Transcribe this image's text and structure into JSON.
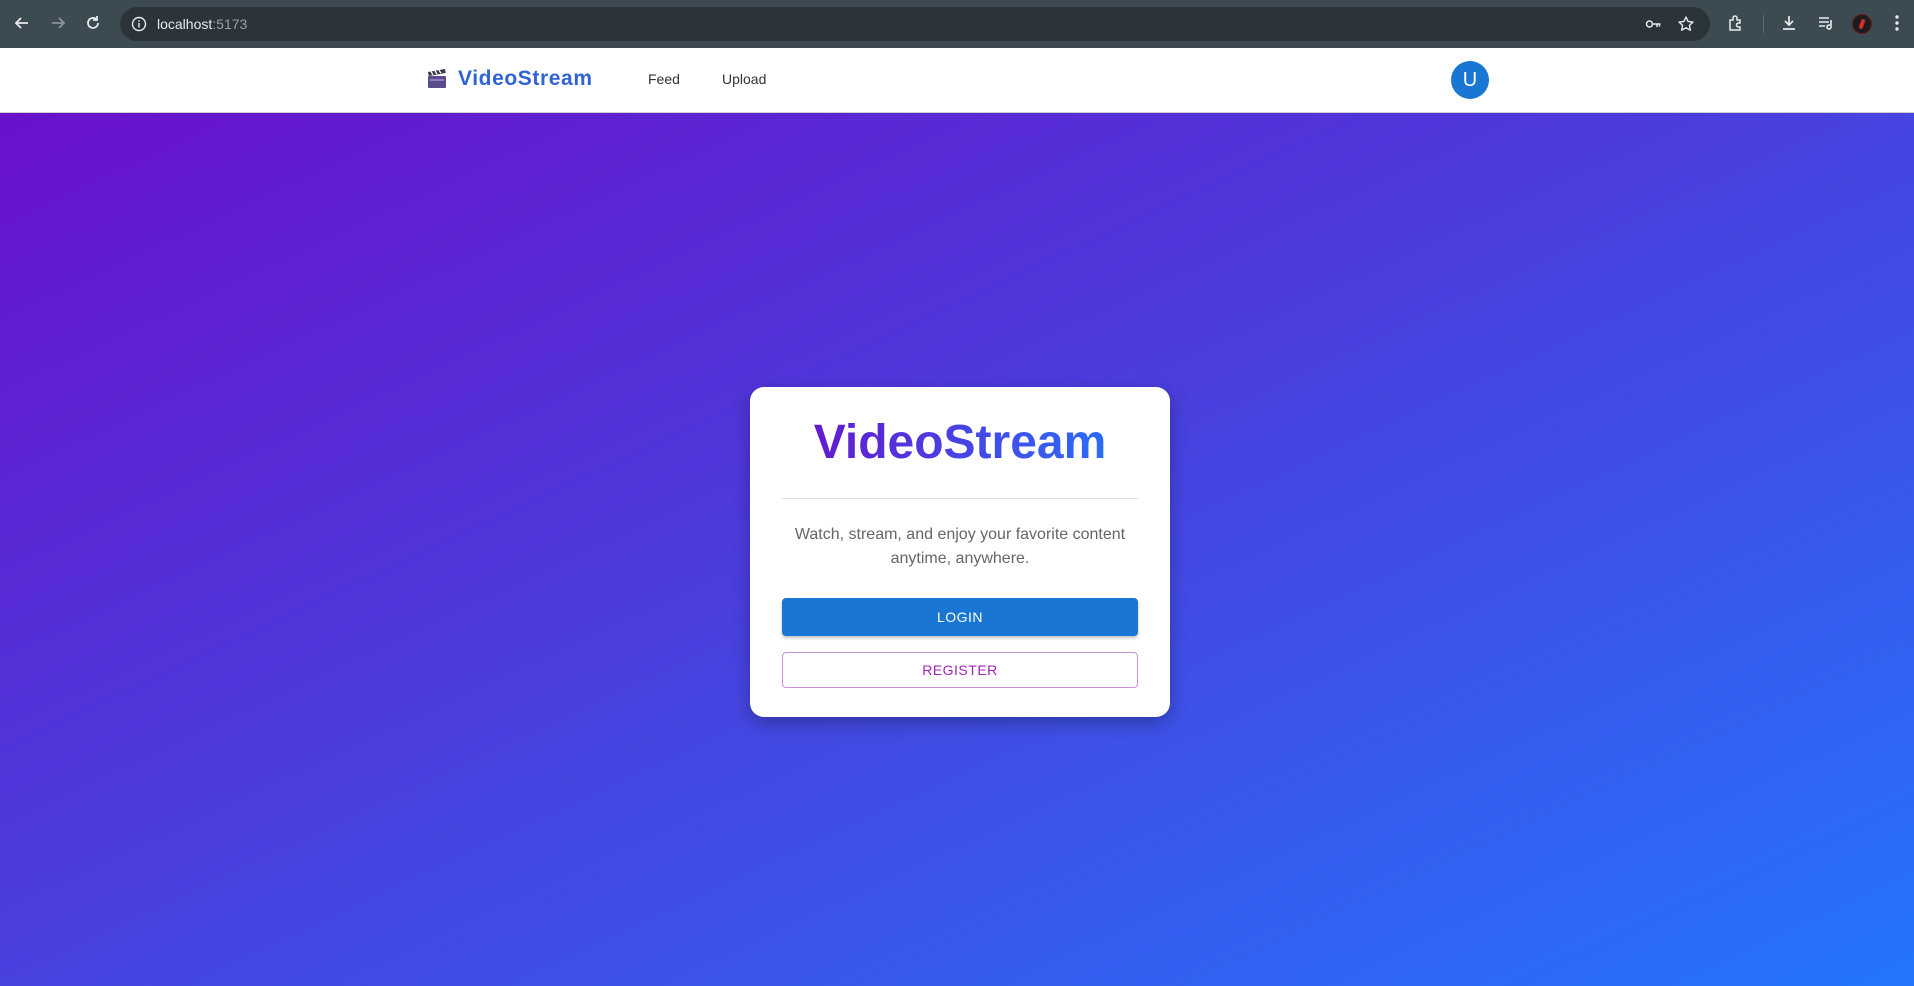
{
  "browser": {
    "url_host": "localhost",
    "url_port": ":5173"
  },
  "header": {
    "brand": "VideoStream",
    "nav": [
      "Feed",
      "Upload"
    ],
    "avatar_initial": "U"
  },
  "card": {
    "title": "VideoStream",
    "tagline": "Watch, stream, and enjoy your favorite content anytime, anywhere.",
    "login_label": "LOGIN",
    "register_label": "REGISTER"
  },
  "colors": {
    "primary": "#1976d2",
    "secondary": "#9c27b0",
    "gradient_start": "#6a11cb",
    "gradient_end": "#2575fc"
  }
}
